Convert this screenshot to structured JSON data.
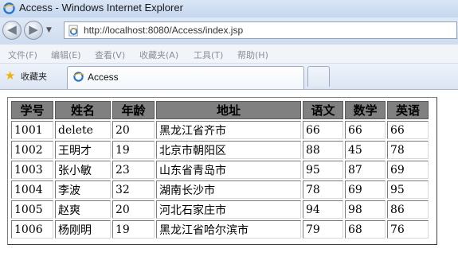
{
  "window": {
    "title": "Access - Windows Internet Explorer"
  },
  "address": {
    "url": "http://localhost:8080/Access/index.jsp"
  },
  "menu": [
    "文件(F)",
    "编辑(E)",
    "查看(V)",
    "收藏夹(A)",
    "工具(T)",
    "帮助(H)"
  ],
  "favorites": {
    "label": "收藏夹"
  },
  "tab": {
    "label": "Access"
  },
  "table": {
    "headers": [
      "学号",
      "姓名",
      "年龄",
      "地址",
      "语文",
      "数学",
      "英语"
    ],
    "rows": [
      [
        "1001",
        "delete",
        "20",
        "黑龙江省齐市",
        "66",
        "66",
        "66"
      ],
      [
        "1002",
        "王明才",
        "19",
        "北京市朝阳区",
        "88",
        "45",
        "78"
      ],
      [
        "1003",
        "张小敏",
        "23",
        "山东省青岛市",
        "95",
        "87",
        "69"
      ],
      [
        "1004",
        "李波",
        "32",
        "湖南长沙市",
        "78",
        "69",
        "95"
      ],
      [
        "1005",
        "赵爽",
        "20",
        "河北石家庄市",
        "94",
        "98",
        "86"
      ],
      [
        "1006",
        "杨刚明",
        "19",
        "黑龙江省哈尔滨市",
        "79",
        "68",
        "76"
      ]
    ]
  },
  "icons": {
    "title": "ie-icon",
    "address": "ie-page-icon",
    "favorites": "star-icon",
    "tab": "ie-page-icon"
  }
}
